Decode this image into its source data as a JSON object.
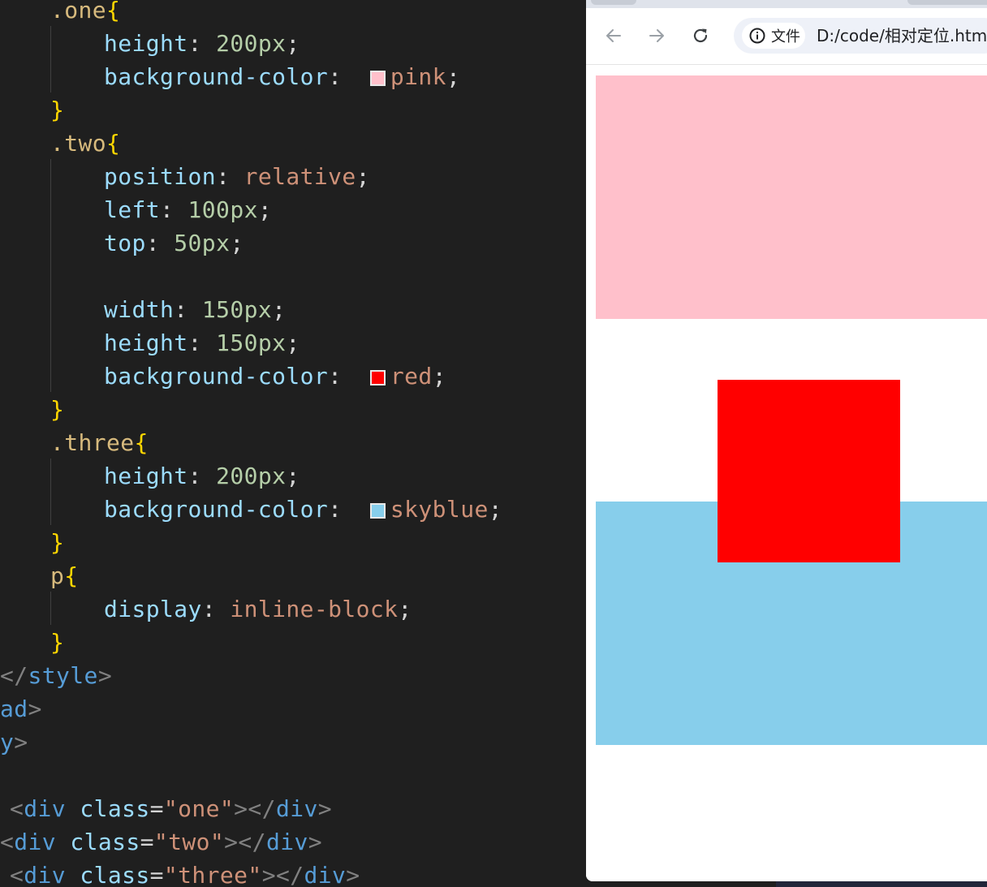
{
  "editor": {
    "lines": [
      {
        "tokens": [
          {
            "t": ".one",
            "c": "sel"
          },
          {
            "t": "{",
            "c": "brace"
          }
        ]
      },
      {
        "tokens": [
          {
            "t": "height",
            "c": "prop"
          },
          {
            "t": ": ",
            "c": "punc"
          },
          {
            "t": "200px",
            "c": "num"
          },
          {
            "t": ";",
            "c": "punc"
          }
        ]
      },
      {
        "tokens": [
          {
            "t": "background-color",
            "c": "prop"
          },
          {
            "t": ":  ",
            "c": "punc"
          },
          {
            "swatch": "#ffc0cb"
          },
          {
            "t": "pink",
            "c": "kw"
          },
          {
            "t": ";",
            "c": "punc"
          }
        ]
      },
      {
        "tokens": [
          {
            "t": "}",
            "c": "brace"
          }
        ]
      },
      {
        "tokens": [
          {
            "t": ".two",
            "c": "sel"
          },
          {
            "t": "{",
            "c": "brace"
          }
        ]
      },
      {
        "tokens": [
          {
            "t": "position",
            "c": "prop"
          },
          {
            "t": ": ",
            "c": "punc"
          },
          {
            "t": "relative",
            "c": "kw"
          },
          {
            "t": ";",
            "c": "punc"
          }
        ]
      },
      {
        "tokens": [
          {
            "t": "left",
            "c": "prop"
          },
          {
            "t": ": ",
            "c": "punc"
          },
          {
            "t": "100px",
            "c": "num"
          },
          {
            "t": ";",
            "c": "punc"
          }
        ]
      },
      {
        "tokens": [
          {
            "t": "top",
            "c": "prop"
          },
          {
            "t": ": ",
            "c": "punc"
          },
          {
            "t": "50px",
            "c": "num"
          },
          {
            "t": ";",
            "c": "punc"
          }
        ]
      },
      {
        "tokens": []
      },
      {
        "tokens": [
          {
            "t": "width",
            "c": "prop"
          },
          {
            "t": ": ",
            "c": "punc"
          },
          {
            "t": "150px",
            "c": "num"
          },
          {
            "t": ";",
            "c": "punc"
          }
        ]
      },
      {
        "tokens": [
          {
            "t": "height",
            "c": "prop"
          },
          {
            "t": ": ",
            "c": "punc"
          },
          {
            "t": "150px",
            "c": "num"
          },
          {
            "t": ";",
            "c": "punc"
          }
        ]
      },
      {
        "tokens": [
          {
            "t": "background-color",
            "c": "prop"
          },
          {
            "t": ":  ",
            "c": "punc"
          },
          {
            "swatch": "#ff0000"
          },
          {
            "t": "red",
            "c": "kw"
          },
          {
            "t": ";",
            "c": "punc"
          }
        ]
      },
      {
        "tokens": [
          {
            "t": "}",
            "c": "brace"
          }
        ]
      },
      {
        "tokens": [
          {
            "t": ".three",
            "c": "sel"
          },
          {
            "t": "{",
            "c": "brace"
          }
        ]
      },
      {
        "tokens": [
          {
            "t": "height",
            "c": "prop"
          },
          {
            "t": ": ",
            "c": "punc"
          },
          {
            "t": "200px",
            "c": "num"
          },
          {
            "t": ";",
            "c": "punc"
          }
        ]
      },
      {
        "tokens": [
          {
            "t": "background-color",
            "c": "prop"
          },
          {
            "t": ":  ",
            "c": "punc"
          },
          {
            "swatch": "#87ceeb"
          },
          {
            "t": "skyblue",
            "c": "kw"
          },
          {
            "t": ";",
            "c": "punc"
          }
        ]
      },
      {
        "tokens": [
          {
            "t": "}",
            "c": "brace"
          }
        ]
      },
      {
        "tokens": [
          {
            "t": "p",
            "c": "sel"
          },
          {
            "t": "{",
            "c": "brace"
          }
        ]
      },
      {
        "tokens": [
          {
            "t": "display",
            "c": "prop"
          },
          {
            "t": ": ",
            "c": "punc"
          },
          {
            "t": "inline-block",
            "c": "kw"
          },
          {
            "t": ";",
            "c": "punc"
          }
        ]
      },
      {
        "tokens": [
          {
            "t": "}",
            "c": "brace"
          }
        ]
      },
      {
        "tokens": [
          {
            "t": "</",
            "c": "bracket"
          },
          {
            "t": "style",
            "c": "tag"
          },
          {
            "t": ">",
            "c": "bracket"
          }
        ]
      },
      {
        "tokens": [
          {
            "t": "ad",
            "c": "tag"
          },
          {
            "t": ">",
            "c": "bracket"
          }
        ]
      },
      {
        "tokens": [
          {
            "t": "y",
            "c": "tag"
          },
          {
            "t": ">",
            "c": "bracket"
          }
        ]
      },
      {
        "tokens": []
      },
      {
        "tokens": [
          {
            "t": "<",
            "c": "bracket"
          },
          {
            "t": "div",
            "c": "tag"
          },
          {
            "t": " ",
            "c": "punc"
          },
          {
            "t": "class",
            "c": "attr"
          },
          {
            "t": "=",
            "c": "punc"
          },
          {
            "t": "\"one\"",
            "c": "str"
          },
          {
            "t": "></",
            "c": "bracket"
          },
          {
            "t": "div",
            "c": "tag"
          },
          {
            "t": ">",
            "c": "bracket"
          }
        ]
      },
      {
        "tokens": [
          {
            "t": "<",
            "c": "bracket"
          },
          {
            "t": "div",
            "c": "tag"
          },
          {
            "t": " ",
            "c": "punc"
          },
          {
            "t": "class",
            "c": "attr"
          },
          {
            "t": "=",
            "c": "punc"
          },
          {
            "t": "\"two\"",
            "c": "str"
          },
          {
            "t": "></",
            "c": "bracket"
          },
          {
            "t": "div",
            "c": "tag"
          },
          {
            "t": ">",
            "c": "bracket"
          }
        ]
      },
      {
        "tokens": [
          {
            "t": "<",
            "c": "bracket"
          },
          {
            "t": "div",
            "c": "tag"
          },
          {
            "t": " ",
            "c": "punc"
          },
          {
            "t": "class",
            "c": "attr"
          },
          {
            "t": "=",
            "c": "punc"
          },
          {
            "t": "\"three\"",
            "c": "str"
          },
          {
            "t": "></",
            "c": "bracket"
          },
          {
            "t": "div",
            "c": "tag"
          },
          {
            "t": ">",
            "c": "bracket"
          }
        ]
      }
    ]
  },
  "browser": {
    "back_icon": "arrow-left-icon",
    "forward_icon": "arrow-right-icon",
    "reload_icon": "reload-icon",
    "site_info_icon": "info-icon",
    "site_info_label": "文件",
    "url": "D:/code/相对定位.htm",
    "page": {
      "one_color": "#ffc0cb",
      "two_color": "#ff0000",
      "three_color": "#87ceeb"
    }
  }
}
